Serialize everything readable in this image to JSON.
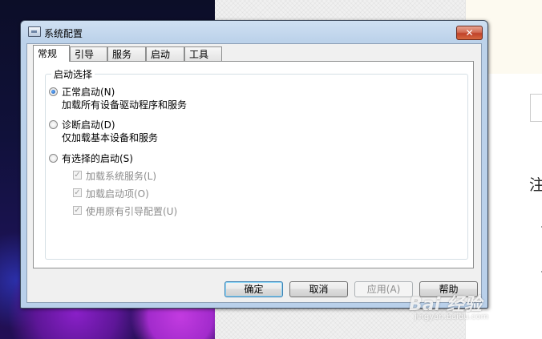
{
  "background": {
    "right_heading": "注"
  },
  "window": {
    "title": "系统配置",
    "close_symbol": "✕",
    "tabs": [
      "常规",
      "引导",
      "服务",
      "启动",
      "工具"
    ],
    "group": {
      "label": "启动选择",
      "options": [
        {
          "label": "正常启动(N)",
          "description": "加载所有设备驱动程序和服务",
          "checked": true
        },
        {
          "label": "诊断启动(D)",
          "description": "仅加载基本设备和服务",
          "checked": false
        },
        {
          "label": "有选择的启动(S)",
          "description": "",
          "checked": false
        }
      ],
      "sub_options": [
        {
          "label": "加载系统服务(L)",
          "checked": true,
          "enabled": false
        },
        {
          "label": "加载启动项(O)",
          "checked": true,
          "enabled": false
        },
        {
          "label": "使用原有引导配置(U)",
          "checked": true,
          "enabled": false
        }
      ]
    },
    "buttons": {
      "ok": "确定",
      "cancel": "取消",
      "apply": "应用(A)",
      "help": "帮助"
    }
  },
  "watermark": {
    "brand": "Bai 经验",
    "url": "jingyan.baidu.com"
  }
}
